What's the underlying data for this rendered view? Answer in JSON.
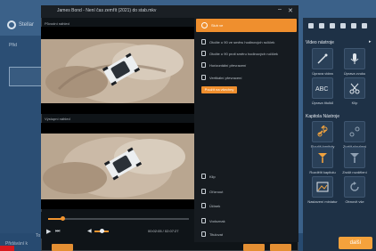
{
  "background_app": {
    "logo_text": "Stellar",
    "sidebar_item": "Přid",
    "bottom_text": "Přidávání k",
    "bottom_tail": "To"
  },
  "right_panel": {
    "section_video": "Video nástroje",
    "section_chapter": "Kapitola Nástroje",
    "video_tools": [
      "Úprava videa",
      "Úprava zvuku",
      "Úprava titulků",
      "Klip"
    ],
    "chapter_tools": [
      "Sloučit kapitoly",
      "Zrušit sloučení",
      "Rozdělit kapitolu",
      "Zrušit rozdělení",
      "Nastavení miniatur",
      "Obnovit vše"
    ],
    "next_label": "další"
  },
  "dialog": {
    "title": "James Bond - Není čas zemřít (2021) do stab.mkv",
    "label_original": "Původní náhled",
    "label_output": "Výstupní náhled",
    "time": "00:02:05 / 02:07:27"
  },
  "menu": {
    "top_label": "Sluh ve",
    "items": [
      "Otočte o 90 ve směru hodinových ručiček",
      "Otočte o 90 proti směru hodinových ručiček",
      "Horizontální převracení",
      "Vertikální převracení"
    ],
    "reset_label": "Použít na všechny",
    "bottom_items": [
      "Klip",
      "Oříznout",
      "Účinek",
      "Vodoznak",
      "Titulovat"
    ]
  },
  "colors": {
    "accent": "#ef8f2e",
    "panel": "#1e3146",
    "dialog": "#0f1418"
  }
}
